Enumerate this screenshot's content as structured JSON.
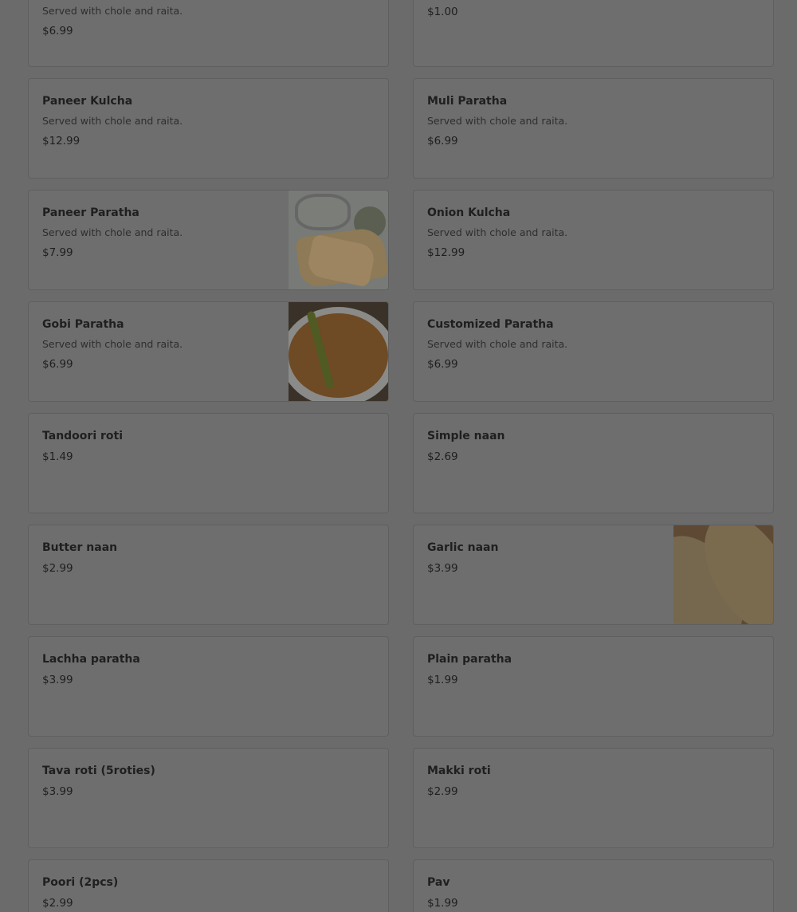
{
  "menu": {
    "items": [
      {
        "name": "",
        "desc": "Served with chole and raita.",
        "price": "$6.99"
      },
      {
        "name": "",
        "desc": "",
        "price": "$1.00"
      },
      {
        "name": "Paneer Kulcha",
        "desc": "Served with chole and raita.",
        "price": "$12.99"
      },
      {
        "name": "Muli Paratha",
        "desc": "Served with chole and raita.",
        "price": "$6.99"
      },
      {
        "name": "Paneer Paratha",
        "desc": "Served with chole and raita.",
        "price": "$7.99",
        "image": "paneer-paratha-photo"
      },
      {
        "name": "Onion Kulcha",
        "desc": "Served with chole and raita.",
        "price": "$12.99"
      },
      {
        "name": "Gobi Paratha",
        "desc": "Served with chole and raita.",
        "price": "$6.99",
        "image": "gobi-paratha-photo"
      },
      {
        "name": "Customized Paratha",
        "desc": "Served with chole and raita.",
        "price": "$6.99"
      },
      {
        "name": "Tandoori roti",
        "price": "$1.49"
      },
      {
        "name": "Simple naan",
        "price": "$2.69"
      },
      {
        "name": "Butter naan",
        "price": "$2.99"
      },
      {
        "name": "Garlic naan",
        "price": "$3.99",
        "image": "garlic-naan-photo"
      },
      {
        "name": "Lachha paratha",
        "price": "$3.99"
      },
      {
        "name": "Plain paratha",
        "price": "$1.99"
      },
      {
        "name": "Tava roti (5roties)",
        "price": "$3.99"
      },
      {
        "name": "Makki roti",
        "price": "$2.99"
      },
      {
        "name": "Poori (2pcs)",
        "price": "$2.99"
      },
      {
        "name": "Pav",
        "price": "$1.99"
      }
    ]
  }
}
